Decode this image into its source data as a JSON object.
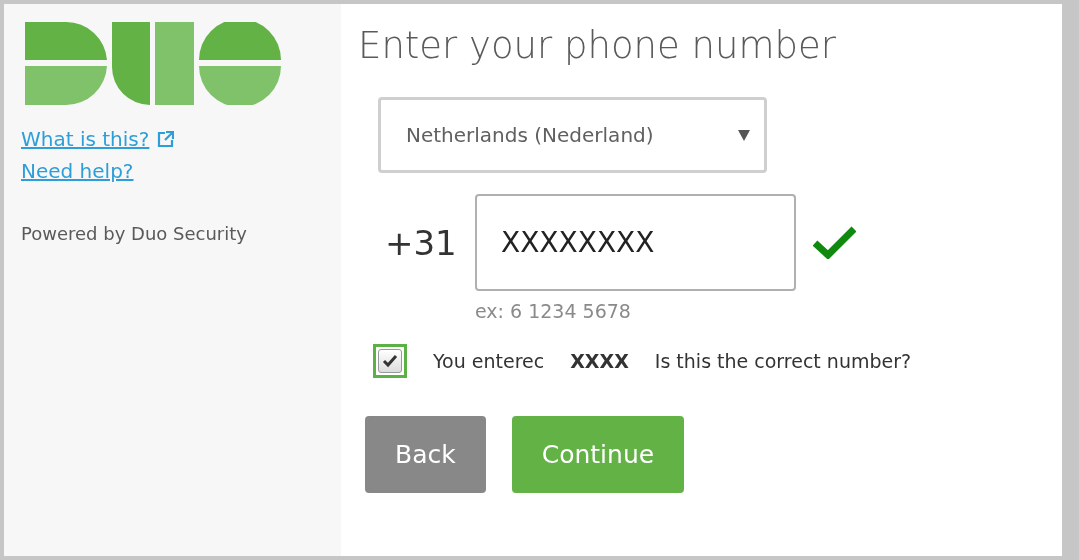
{
  "sidebar": {
    "links": [
      {
        "label": "What is this?",
        "external": true
      },
      {
        "label": "Need help?",
        "external": false
      }
    ],
    "footer": "Powered by Duo Security"
  },
  "main": {
    "title": "Enter your phone number",
    "country_select": {
      "value": "Netherlands (Nederland)"
    },
    "phone": {
      "prefix": "+31",
      "value": "XXXXXXXX",
      "valid": true,
      "hint": "ex: 6 1234 5678"
    },
    "confirm": {
      "checked": true,
      "texts": [
        "You enterec",
        "XXXX",
        "Is this the correct number?"
      ]
    },
    "buttons": [
      {
        "label": "Back",
        "kind": "secondary"
      },
      {
        "label": "Continue",
        "kind": "primary"
      }
    ]
  }
}
